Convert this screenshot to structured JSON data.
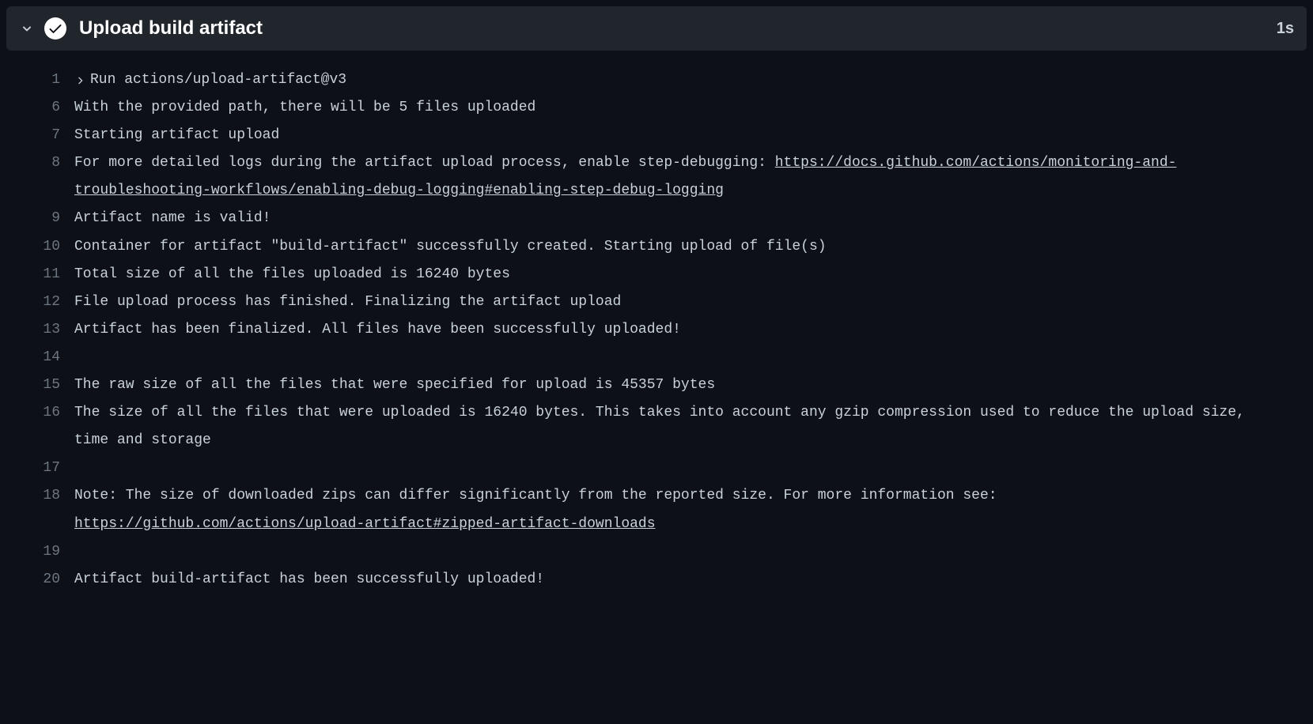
{
  "step": {
    "title": "Upload build artifact",
    "duration": "1s",
    "status_icon": "check"
  },
  "log": {
    "rows": [
      {
        "n": "1",
        "kind": "fold",
        "text": "Run actions/upload-artifact@v3"
      },
      {
        "n": "6",
        "kind": "plain",
        "text": "With the provided path, there will be 5 files uploaded"
      },
      {
        "n": "7",
        "kind": "plain",
        "text": "Starting artifact upload"
      },
      {
        "n": "8",
        "kind": "link",
        "prefix": "For more detailed logs during the artifact upload process, enable step-debugging: ",
        "link": "https://docs.github.com/actions/monitoring-and-troubleshooting-workflows/enabling-debug-logging#enabling-step-debug-logging"
      },
      {
        "n": "9",
        "kind": "plain",
        "text": "Artifact name is valid!"
      },
      {
        "n": "10",
        "kind": "plain",
        "text": "Container for artifact \"build-artifact\" successfully created. Starting upload of file(s)"
      },
      {
        "n": "11",
        "kind": "plain",
        "text": "Total size of all the files uploaded is 16240 bytes"
      },
      {
        "n": "12",
        "kind": "plain",
        "text": "File upload process has finished. Finalizing the artifact upload"
      },
      {
        "n": "13",
        "kind": "plain",
        "text": "Artifact has been finalized. All files have been successfully uploaded!"
      },
      {
        "n": "14",
        "kind": "plain",
        "text": ""
      },
      {
        "n": "15",
        "kind": "plain",
        "text": "The raw size of all the files that were specified for upload is 45357 bytes"
      },
      {
        "n": "16",
        "kind": "plain",
        "text": "The size of all the files that were uploaded is 16240 bytes. This takes into account any gzip compression used to reduce the upload size, time and storage"
      },
      {
        "n": "17",
        "kind": "plain",
        "text": ""
      },
      {
        "n": "18",
        "kind": "link",
        "prefix": "Note: The size of downloaded zips can differ significantly from the reported size. For more information see: ",
        "link": "https://github.com/actions/upload-artifact#zipped-artifact-downloads"
      },
      {
        "n": "19",
        "kind": "plain",
        "text": ""
      },
      {
        "n": "20",
        "kind": "plain",
        "text": "Artifact build-artifact has been successfully uploaded!"
      }
    ]
  }
}
